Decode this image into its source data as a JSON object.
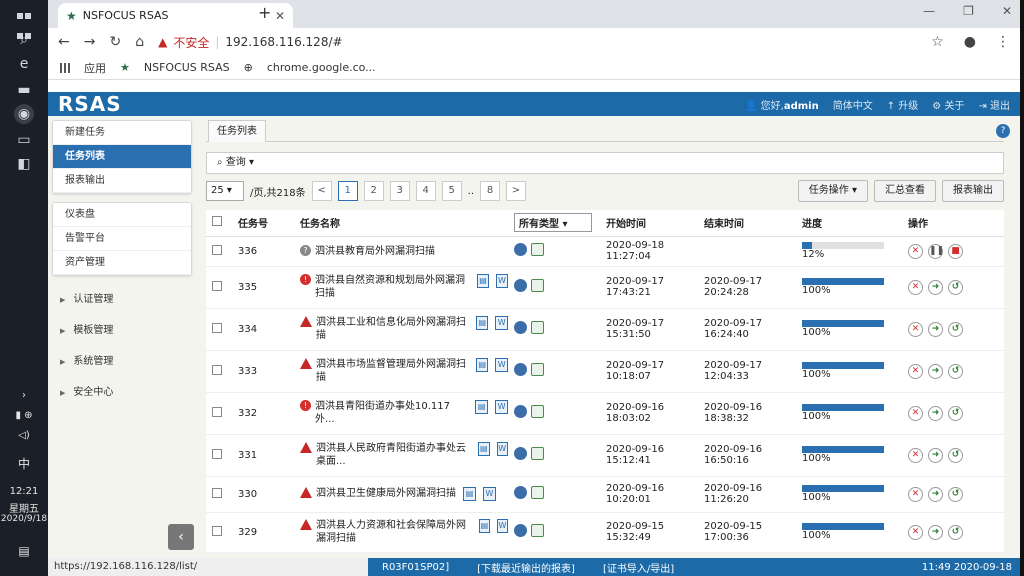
{
  "taskbar": {
    "time": "12:21",
    "weekday": "星期五",
    "date": "2020/9/18",
    "ime": "中"
  },
  "browser": {
    "tab_title": "NSFOCUS RSAS",
    "insecure": "不安全",
    "url": "192.168.116.128/#",
    "bookmarks": [
      "应用",
      "NSFOCUS RSAS",
      "chrome.google.co..."
    ]
  },
  "app": {
    "logo": "RSAS",
    "greeting": "您好,",
    "user": "admin",
    "lang": "简体中文",
    "upgrade": "升级",
    "about": "关于",
    "logout": "退出"
  },
  "sidebar": {
    "group1": [
      "新建任务",
      "任务列表",
      "报表输出"
    ],
    "group2": [
      "仪表盘",
      "告警平台",
      "资产管理"
    ],
    "collapsibles": [
      "认证管理",
      "模板管理",
      "系统管理",
      "安全中心"
    ]
  },
  "main": {
    "crumb": "任务列表",
    "query": "查询",
    "page_size": "25",
    "per_page_label": "/页,共218条",
    "pages": [
      "<",
      "1",
      "2",
      "3",
      "4",
      "5",
      "..",
      "8",
      ">"
    ],
    "task_ops": "任务操作",
    "summary": "汇总查看",
    "report_export": "报表输出"
  },
  "table": {
    "headers": {
      "id": "任务号",
      "name": "任务名称",
      "type": "所有类型",
      "start": "开始时间",
      "end": "结束时间",
      "progress": "进度",
      "ops": "操作"
    },
    "rows": [
      {
        "id": "336",
        "name": "泗洪县教育局外网漏洞扫描",
        "start1": "2020-09-18",
        "start2": "11:27:04",
        "end1": "",
        "end2": "",
        "progress": "12%",
        "pct": 12
      },
      {
        "id": "335",
        "name": "泗洪县自然资源和规划局外网漏洞扫描",
        "start1": "2020-09-17",
        "start2": "17:43:21",
        "end1": "2020-09-17",
        "end2": "20:24:28",
        "progress": "100%",
        "pct": 100
      },
      {
        "id": "334",
        "name": "泗洪县工业和信息化局外网漏洞扫描",
        "start1": "2020-09-17",
        "start2": "15:31:50",
        "end1": "2020-09-17",
        "end2": "16:24:40",
        "progress": "100%",
        "pct": 100
      },
      {
        "id": "333",
        "name": "泗洪县市场监督管理局外网漏洞扫描",
        "start1": "2020-09-17",
        "start2": "10:18:07",
        "end1": "2020-09-17",
        "end2": "12:04:33",
        "progress": "100%",
        "pct": 100
      },
      {
        "id": "332",
        "name": "泗洪县青阳街道办事处10.117外...",
        "start1": "2020-09-16",
        "start2": "18:03:02",
        "end1": "2020-09-16",
        "end2": "18:38:32",
        "progress": "100%",
        "pct": 100
      },
      {
        "id": "331",
        "name": "泗洪县人民政府青阳街道办事处云桌面...",
        "start1": "2020-09-16",
        "start2": "15:12:41",
        "end1": "2020-09-16",
        "end2": "16:50:16",
        "progress": "100%",
        "pct": 100
      },
      {
        "id": "330",
        "name": "泗洪县卫生健康局外网漏洞扫描",
        "start1": "2020-09-16",
        "start2": "10:20:01",
        "end1": "2020-09-16",
        "end2": "11:26:20",
        "progress": "100%",
        "pct": 100
      },
      {
        "id": "329",
        "name": "泗洪县人力资源和社会保障局外网漏洞扫描",
        "start1": "2020-09-15",
        "start2": "15:32:49",
        "end1": "2020-09-15",
        "end2": "17:00:36",
        "progress": "100%",
        "pct": 100
      }
    ]
  },
  "statusbar": {
    "hover_url": "https://192.168.116.128/list/",
    "version": "R03F01SP02]",
    "download": "[下载最近输出的报表]",
    "cert": "[证书导入/导出]",
    "clock": "11:49 2020-09-18"
  }
}
